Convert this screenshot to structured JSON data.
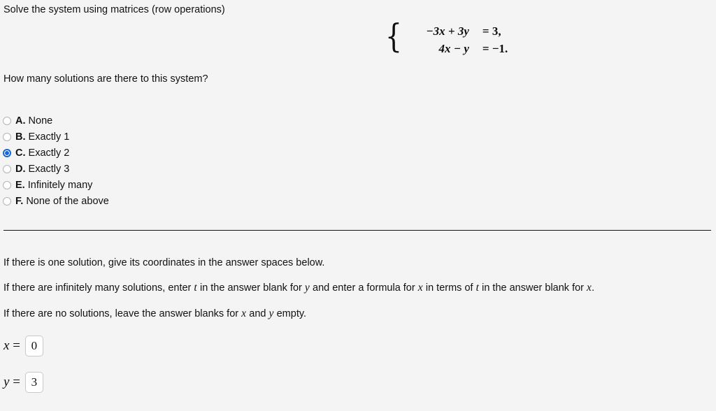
{
  "title": "Solve the system using matrices (row operations)",
  "system": {
    "brace": "{",
    "equations": [
      {
        "lhs_pre": "−3",
        "lhs_var1": "x",
        "op": "+",
        "lhs_coef2": "3",
        "lhs_var2": "y",
        "rhs": "= 3,"
      },
      {
        "lhs_pre": "4",
        "lhs_var1": "x",
        "op": "−",
        "lhs_coef2": "",
        "lhs_var2": "y",
        "rhs": "= −1."
      }
    ],
    "line1_lhs": "−3x + 3y",
    "line1_rhs": "= 3,",
    "line2_lhs": "4x − y",
    "line2_rhs": "= −1."
  },
  "question": "How many solutions are there to this system?",
  "options": [
    {
      "letter": "A.",
      "label": "None",
      "selected": false
    },
    {
      "letter": "B.",
      "label": "Exactly 1",
      "selected": false
    },
    {
      "letter": "C.",
      "label": "Exactly 2",
      "selected": true
    },
    {
      "letter": "D.",
      "label": "Exactly 3",
      "selected": false
    },
    {
      "letter": "E.",
      "label": "Infinitely many",
      "selected": false
    },
    {
      "letter": "F.",
      "label": "None of the above",
      "selected": false
    }
  ],
  "instructions": {
    "line1": "If there is one solution, give its coordinates in the answer spaces below.",
    "line2_a": "If there are infinitely many solutions, enter ",
    "line2_t1": "t",
    "line2_b": " in the answer blank for ",
    "line2_y": "y",
    "line2_c": " and enter a formula for ",
    "line2_x": "x",
    "line2_d": " in terms of ",
    "line2_t2": "t",
    "line2_e": " in the answer blank for ",
    "line2_x2": "x",
    "line2_f": ".",
    "line3_a": "If there are no solutions, leave the answer blanks for ",
    "line3_x": "x",
    "line3_b": " and ",
    "line3_y": "y",
    "line3_c": " empty."
  },
  "answers": {
    "x_label_var": "x",
    "x_label_eq": "=",
    "x_value": "0",
    "y_label_var": "y",
    "y_label_eq": "=",
    "y_value": "3"
  },
  "colors": {
    "background": "#f4f4f4",
    "text": "#111111",
    "accent": "#1567d3",
    "divider": "#141414",
    "field_border": "#c9c9c9"
  }
}
